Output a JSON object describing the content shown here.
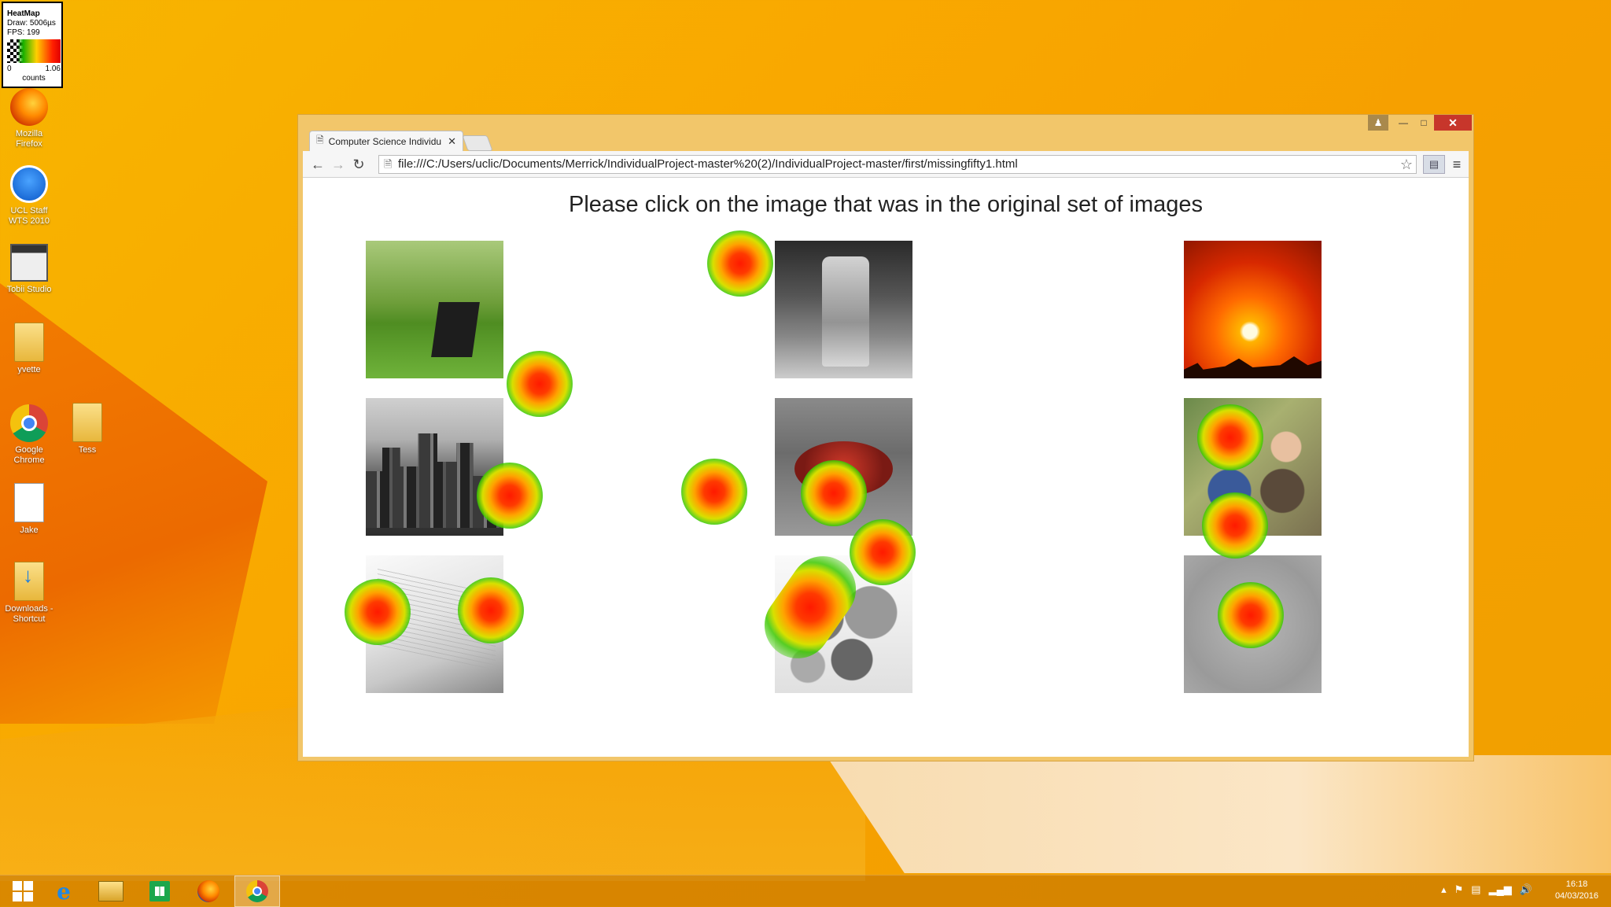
{
  "heatmap_legend": {
    "title": "HeatMap",
    "draw": "Draw: 5006µs",
    "fps": "FPS: 199",
    "min": "0",
    "max": "1.06",
    "unit": "counts"
  },
  "desktop_icons": [
    {
      "label": "Mozilla Firefox",
      "icon": "firefox-icon"
    },
    {
      "label": "UCL Staff WTS 2010",
      "icon": "ucl-icon"
    },
    {
      "label": "Tobii Studio",
      "icon": "tobii-icon"
    },
    {
      "label": "yvette",
      "icon": "folder-icon"
    },
    {
      "label": "Google Chrome",
      "icon": "chrome-icon"
    },
    {
      "label": "Tess",
      "icon": "folder-icon"
    },
    {
      "label": "Jake",
      "icon": "document-icon"
    },
    {
      "label": "Downloads - Shortcut",
      "icon": "downloads-folder-icon"
    }
  ],
  "browser": {
    "tab_title": "Computer Science Individu",
    "url": "file:///C:/Users/uclic/Documents/Merrick/IndividualProject-master%20(2)/IndividualProject-master/first/missingfifty1.html"
  },
  "page": {
    "question": "Please click on the image that was in the original set of images",
    "images": [
      {
        "subject": "laptop on grass"
      },
      {
        "subject": "glass jars"
      },
      {
        "subject": "sunset"
      },
      {
        "subject": "city skyline"
      },
      {
        "subject": "crab"
      },
      {
        "subject": "figurines"
      },
      {
        "subject": "open book"
      },
      {
        "subject": "fruit"
      },
      {
        "subject": "beetle"
      }
    ]
  },
  "taskbar": {
    "items": [
      "start",
      "internet-explorer",
      "file-explorer",
      "store",
      "firefox",
      "chrome"
    ],
    "active": "chrome",
    "time": "16:18",
    "date": "04/03/2016"
  },
  "colors": {
    "desktop": "#f7b500",
    "window_frame": "#f2c66a",
    "close_button": "#c7362b"
  }
}
